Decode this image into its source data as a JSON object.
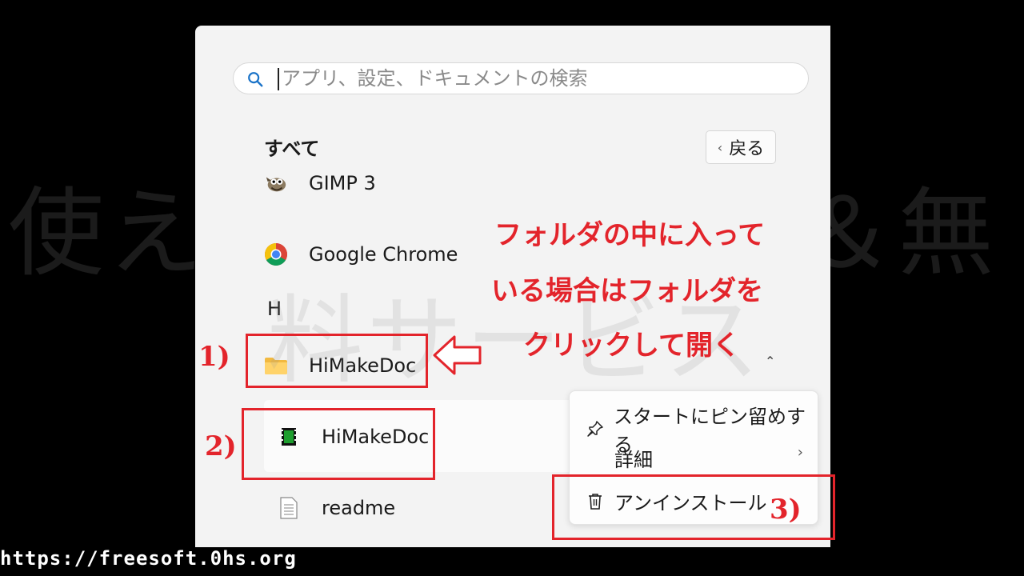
{
  "search": {
    "placeholder": "アプリ、設定、ドキュメントの検索"
  },
  "section": {
    "title": "すべて",
    "back_label": "戻る"
  },
  "apps": [
    {
      "label": "GIMP 3",
      "icon": "gimp-icon"
    },
    {
      "label": "Google Chrome",
      "icon": "chrome-icon"
    }
  ],
  "group_letter": "H",
  "folder": {
    "label": "HiMakeDoc",
    "icon": "folder-icon"
  },
  "folder_items": [
    {
      "label": "HiMakeDoc",
      "icon": "app-icon"
    },
    {
      "label": "readme",
      "icon": "document-icon"
    }
  ],
  "context_menu": {
    "pin_label": "スタートにピン留めする",
    "details_label": "詳細",
    "uninstall_label": "アンインストール"
  },
  "annotations": {
    "step1": "1)",
    "step2": "2)",
    "step3": "3)",
    "note_line1": "フォルダの中に入って",
    "note_line2": "いる場合はフォルダを",
    "note_line3": "クリックして開く"
  },
  "watermark": {
    "line1": "使える無料ソフト＆無",
    "line2": "料サービス"
  },
  "footer_url": "https://freesoft.0hs.org",
  "colors": {
    "annotation_red": "#e3242b",
    "panel_bg": "#f3f3f3",
    "search_icon": "#1a73c8"
  }
}
